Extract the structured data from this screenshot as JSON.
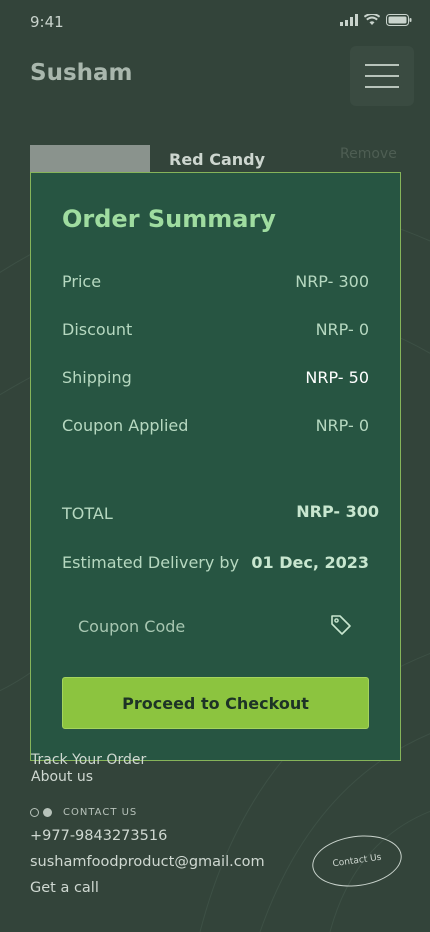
{
  "status": {
    "time": "9:41"
  },
  "header": {
    "brand": "Susham"
  },
  "cart": {
    "product_name": "Red Candy",
    "remove_label": "Remove"
  },
  "summary": {
    "title": "Order Summary",
    "price_label": "Price",
    "price_value": "NRP- 300",
    "discount_label": "Discount",
    "discount_value": "NRP- 0",
    "shipping_label": "Shipping",
    "shipping_value": "NRP- 50",
    "coupon_applied_label": "Coupon Applied",
    "coupon_applied_value": "NRP- 0",
    "total_label": "TOTAL",
    "total_value": "NRP- 300",
    "delivery_label": "Estimated Delivery by",
    "delivery_value": "01 Dec, 2023",
    "coupon_placeholder": "Coupon Code",
    "checkout_label": "Proceed to Checkout"
  },
  "footer": {
    "track_order": "Track Your Order",
    "about_us": "About us",
    "contact_heading": "CONTACT US",
    "phone": "+977-9843273516",
    "email": "sushamfoodproduct@gmail.com",
    "call": "Get a call",
    "contact_button": "Contact Us"
  },
  "colors": {
    "background": "#33443a",
    "panel": "#275542",
    "accent": "#8cc43f",
    "title_green": "#9fdca0"
  }
}
